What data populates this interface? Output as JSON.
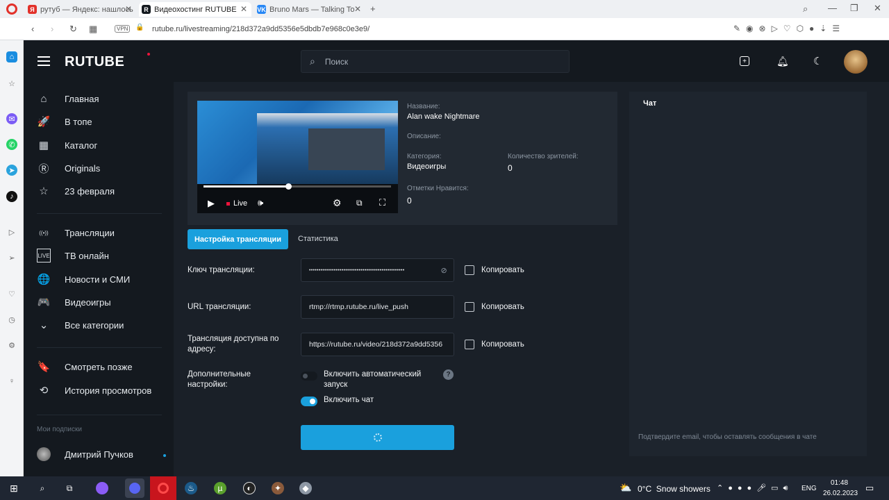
{
  "browser": {
    "tabs": [
      {
        "title": "рутуб — Яндекс: нашлось",
        "favicon": "Я",
        "color": "#e2312a",
        "active": false
      },
      {
        "title": "Видеохостинг RUTUBE",
        "favicon": "R",
        "color": "#14191f",
        "active": true
      },
      {
        "title": "Bruno Mars — Talking To",
        "favicon": "VK",
        "color": "#2787f5",
        "active": false
      }
    ],
    "url": "rutube.ru/livestreaming/218d372a9dd5356e5dbdb7e968c0e3e9/",
    "vpn_label": "VPN"
  },
  "header": {
    "logo": "RUTUBE",
    "search_placeholder": "Поиск"
  },
  "sidebar": {
    "items": [
      {
        "label": "Главная",
        "icon": "home-icon",
        "glyph": "⌂"
      },
      {
        "label": "В топе",
        "icon": "rocket-icon",
        "glyph": "🚀"
      },
      {
        "label": "Каталог",
        "icon": "grid-icon",
        "glyph": "▦"
      },
      {
        "label": "Originals",
        "icon": "originals-icon",
        "glyph": "Ⓡ"
      },
      {
        "label": "23 февраля",
        "icon": "star-icon",
        "glyph": "☆"
      }
    ],
    "items2": [
      {
        "label": "Трансляции",
        "icon": "broadcast-icon",
        "glyph": "((•))"
      },
      {
        "label": "ТВ онлайн",
        "icon": "live-icon",
        "glyph": "LIVE"
      },
      {
        "label": "Новости и СМИ",
        "icon": "globe-icon",
        "glyph": "🌐"
      },
      {
        "label": "Видеоигры",
        "icon": "gamepad-icon",
        "glyph": "🎮"
      },
      {
        "label": "Все категории",
        "icon": "chevron-down-icon",
        "glyph": "⌄"
      }
    ],
    "items3": [
      {
        "label": "Смотреть позже",
        "icon": "bookmark-icon",
        "glyph": "🔖"
      },
      {
        "label": "История просмотров",
        "icon": "history-icon",
        "glyph": "⟲"
      }
    ],
    "subscriptions_title": "Мои подписки",
    "subscription": "Дмитрий Пучков"
  },
  "stream": {
    "name_label": "Название:",
    "name": "Alan wake Nightmare",
    "desc_label": "Описание:",
    "category_label": "Категория:",
    "category": "Видеоигры",
    "viewers_label": "Количество зрителей:",
    "viewers": "0",
    "likes_label": "Отметки Нравится:",
    "likes": "0",
    "live_label": "Live",
    "progress": 0.45
  },
  "tabs": {
    "settings": "Настройка трансляции",
    "stats": "Статистика"
  },
  "form": {
    "key_label": "Ключ трансляции:",
    "key_value": "••••••••••••••••••••••••••••••••••••••••••••••••••",
    "url_label": "URL трансляции:",
    "url_value": "rtmp://rtmp.rutube.ru/live_push",
    "address_label": "Трансляция доступна по адресу:",
    "address_value": "https://rutube.ru/video/218d372a9dd5356",
    "copy": "Копировать",
    "extra_label": "Дополнительные настройки:",
    "autostart_label": "Включить автоматический запуск",
    "chat_toggle_label": "Включить чат",
    "help": "?"
  },
  "chat": {
    "title": "Чат",
    "note": "Подтвердите email, чтобы оставлять сообщения в чате"
  },
  "taskbar": {
    "weather": "0°C  Snow showers",
    "lang": "ENG",
    "time": "01:48",
    "date": "26.02.2023"
  },
  "colors": {
    "accent": "#1aa0dd",
    "red": "#ed143b"
  }
}
